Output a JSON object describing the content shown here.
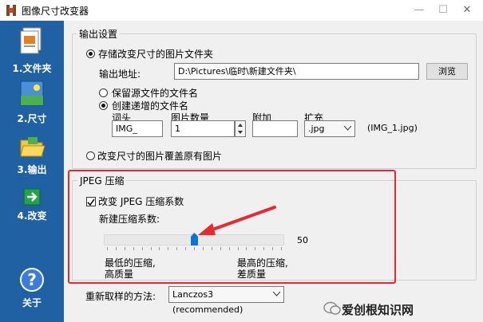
{
  "window": {
    "title": "图像尺寸改变器",
    "minimize": "—",
    "maximize": "☐",
    "close": "✕"
  },
  "sidebar": {
    "items": [
      {
        "label": "1.文件夹",
        "icon": "folder-document-icon"
      },
      {
        "label": "2.尺寸",
        "icon": "landscape-image-icon"
      },
      {
        "label": "3.输出",
        "icon": "open-folder-icon"
      },
      {
        "label": "4.改变",
        "icon": "green-arrow-icon"
      },
      {
        "label": "关于",
        "icon": "help-icon"
      }
    ]
  },
  "output_settings": {
    "legend": "输出设置",
    "store_resized_option": "存储改变尺寸的图片文件夹",
    "output_path_label": "输出地址:",
    "output_path_value": "D:\\Pictures\\临时\\新建文件夹\\",
    "browse_label": "浏览",
    "keep_name_option": "保留源文件的文件名",
    "incremental_name_option": "创建递增的文件名",
    "prefix_label": "词头",
    "prefix_value": "IMG_",
    "count_label": "图片数量",
    "count_value": "1",
    "suffix_label": "附加",
    "suffix_value": "",
    "extension_label": "扩充",
    "extension_value": ".jpg",
    "example_name": "(IMG_1.jpg)",
    "overwrite_option": "改变尺寸的图片覆盖原有图片"
  },
  "jpeg": {
    "legend": "JPEG 压缩",
    "change_compression_label": "改变 JPEG 压缩系数",
    "new_factor_label": "新建压缩系数:",
    "slider_value": "50",
    "slider_fraction": 0.5,
    "low_label_1": "最低的压缩,",
    "low_label_2": "高质量",
    "high_label_1": "最高的压缩,",
    "high_label_2": "差质量"
  },
  "resample": {
    "label": "重新取样的方法:",
    "value": "Lanczos3 (recommended)"
  },
  "watermark": {
    "text": "爱创根知识网"
  },
  "colors": {
    "sidebar": "#1f61a3",
    "highlight": "#e8292f",
    "arrow": "#e8292f",
    "slider_thumb": "#0a74da"
  }
}
